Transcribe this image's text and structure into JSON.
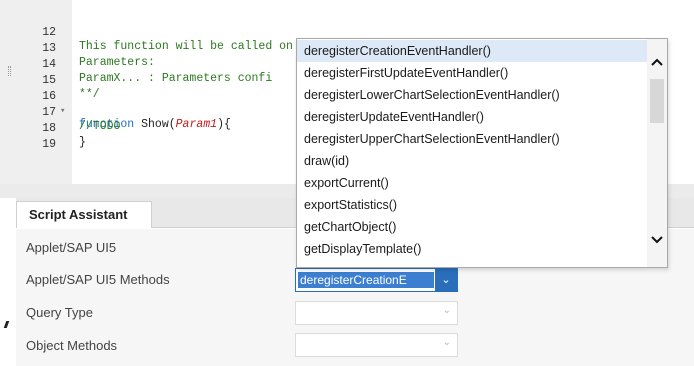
{
  "editor": {
    "lines": [
      {
        "num": "12",
        "fold": "",
        "text": "This function will be called on press of button"
      },
      {
        "num": "13",
        "fold": "",
        "text": "Parameters:"
      },
      {
        "num": "14",
        "fold": "",
        "text": "ParamX... : Parameters confi"
      },
      {
        "num": "15",
        "fold": "",
        "text": "**/"
      },
      {
        "num": "16",
        "fold": "▾",
        "kw": "function ",
        "fn": "Show(",
        "param": "Param1",
        "rest": "){"
      },
      {
        "num": "17",
        "fold": "",
        "text": "//TODO"
      },
      {
        "num": "18",
        "fold": "",
        "plain": "}"
      },
      {
        "num": "19",
        "fold": "",
        "text": ""
      }
    ]
  },
  "script_assistant": {
    "tab_label": "Script Assistant",
    "fields": [
      {
        "label": "Applet/SAP UI5",
        "value": ""
      },
      {
        "label": "Applet/SAP UI5 Methods",
        "value": "deregisterCreationE"
      },
      {
        "label": "Query Type",
        "value": ""
      },
      {
        "label": "Object Methods",
        "value": ""
      }
    ]
  },
  "dropdown": {
    "items": [
      "deregisterCreationEventHandler()",
      "deregisterFirstUpdateEventHandler()",
      "deregisterLowerChartSelectionEventHandler()",
      "deregisterUpdateEventHandler()",
      "deregisterUpperChartSelectionEventHandler()",
      "draw(id)",
      "exportCurrent()",
      "exportStatistics()",
      "getChartObject()",
      "getDisplayTemplate()"
    ],
    "selected_index": 0
  },
  "icons": {
    "scroll_up": "chevron-up-icon",
    "scroll_down": "chevron-down-icon",
    "select_chevron": "chevron-down-icon",
    "fold_toggle": "caret-down-icon"
  },
  "colors": {
    "comment_green": "#2c7a1f",
    "keyword_blue": "#1f6fbf",
    "param_red": "#c81a1a",
    "select_accent": "#2a6ebb",
    "selected_row": "#dde9f6"
  }
}
